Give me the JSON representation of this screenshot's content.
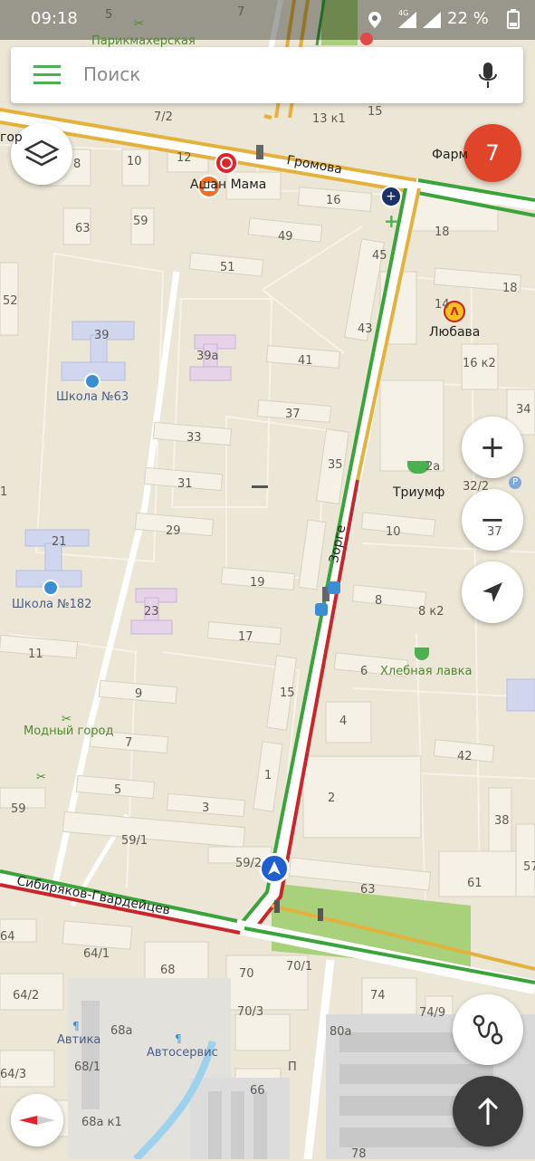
{
  "status": {
    "time": "09:18",
    "network": "4G",
    "battery": "22 %"
  },
  "search": {
    "placeholder": "Поиск"
  },
  "badge": {
    "count": "7"
  },
  "colors": {
    "green_road": "#3aa33a",
    "red_road": "#c8262b",
    "yellow_road": "#e3b23c",
    "brand_green": "#4caf50",
    "nav_blue": "#1f5fd1",
    "park": "#a9d07a"
  },
  "icons": [
    "menu-icon",
    "microphone-icon",
    "layers-icon",
    "zoom-in-icon",
    "zoom-out-icon",
    "my-location-icon",
    "route-icon",
    "navigation-arrow-icon",
    "compass-icon"
  ],
  "zoom": {
    "plus": "+",
    "minus": "−"
  },
  "streets": {
    "gromova": "Громова",
    "zorge": "Зорге",
    "sibiryakov": "Сибиряков-Гвардейцев"
  },
  "pois": {
    "parikmakherskaya": "Парикмахерская",
    "avto_mama": "Ашан Мама",
    "lyubava": "Любава",
    "triumf": "Триумф",
    "khlebnaya_lavka": "Хлебная лавка",
    "shkola63": "Школа №63",
    "shkola182": "Школа №182",
    "modny_gorod": "Модный город",
    "avtika": "Автика",
    "avtoservis": "Автосервис",
    "farm": "Фарм",
    "gor": "гор"
  },
  "houses": {
    "h5": "5",
    "h7": "7",
    "h7_2": "7/2",
    "h13k1": "13 к1",
    "h15": "15",
    "h8": "8",
    "h10": "10",
    "h12": "12",
    "h16": "16",
    "h63": "63",
    "h59": "59",
    "h49": "49",
    "h51": "51",
    "h45": "45",
    "h52": "52",
    "h39": "39",
    "h39a": "39а",
    "h43": "43",
    "h41": "41",
    "h37": "37",
    "h33": "33",
    "h35": "35",
    "h31": "31",
    "h29": "29",
    "h19": "19",
    "h21": "21",
    "h23": "23",
    "h17": "17",
    "h11": "11",
    "h9": "9",
    "h15b": "15",
    "h7b": "7",
    "h5b": "5",
    "h3": "3",
    "h1": "1",
    "h59b": "59",
    "h59_1": "59/1",
    "h59_2": "59/2",
    "h63b": "63",
    "h18": "18",
    "h14": "14",
    "h18b": "18",
    "h16k2": "16 к2",
    "h34": "34",
    "h2a": "2а",
    "h32_2": "32/2",
    "h10b": "10",
    "h37b": "37",
    "h8b": "8",
    "h8k2": "8 к2",
    "h6": "6",
    "h4": "4",
    "h42": "42",
    "h2": "2",
    "h38": "38",
    "h61": "61",
    "h57": "57",
    "h64": "64",
    "h64_1": "64/1",
    "h68": "68",
    "h70": "70",
    "h70_1": "70/1",
    "h70_3": "70/3",
    "h74": "74",
    "h74_9": "74/9",
    "h64_2": "64/2",
    "h68a": "68а",
    "h68_1": "68/1",
    "h80a": "80а",
    "h64_3": "64/3",
    "h66": "66",
    "h68ak1": "68а к1",
    "h78": "78",
    "h1b": "1"
  }
}
